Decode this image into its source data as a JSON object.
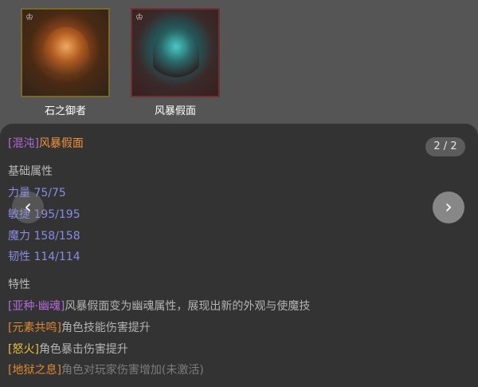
{
  "thumbnails": [
    {
      "label": "石之御者",
      "corner_icon": "crown-icon"
    },
    {
      "label": "风暴假面",
      "corner_icon": "crown-icon"
    }
  ],
  "panel": {
    "title_tag": "[混沌]",
    "title_name": "风暴假面",
    "pager": "2 / 2",
    "base_heading": "基础属性",
    "stats": [
      "力量 75/75",
      "敏捷 195/195",
      "魔力 158/158",
      "韧性 114/114"
    ],
    "traits_heading": "特性",
    "traits": [
      {
        "tag": "[亚种·幽魂]",
        "desc": "风暴假面变为幽魂属性，展现出新的外观与使魔技"
      },
      {
        "tag": "[元素共鸣]",
        "desc": "角色技能伤害提升"
      },
      {
        "tag": "[怒火]",
        "desc": "角色暴击伤害提升"
      },
      {
        "tag": "[地狱之息]",
        "desc": "角色对玩家伤害增加(未激活)"
      }
    ]
  },
  "nav": {
    "prev": "‹",
    "next": "›"
  },
  "colors": {
    "chaos": "#b06ad9",
    "name": "#f0903a",
    "stat": "#8a8ae6"
  }
}
